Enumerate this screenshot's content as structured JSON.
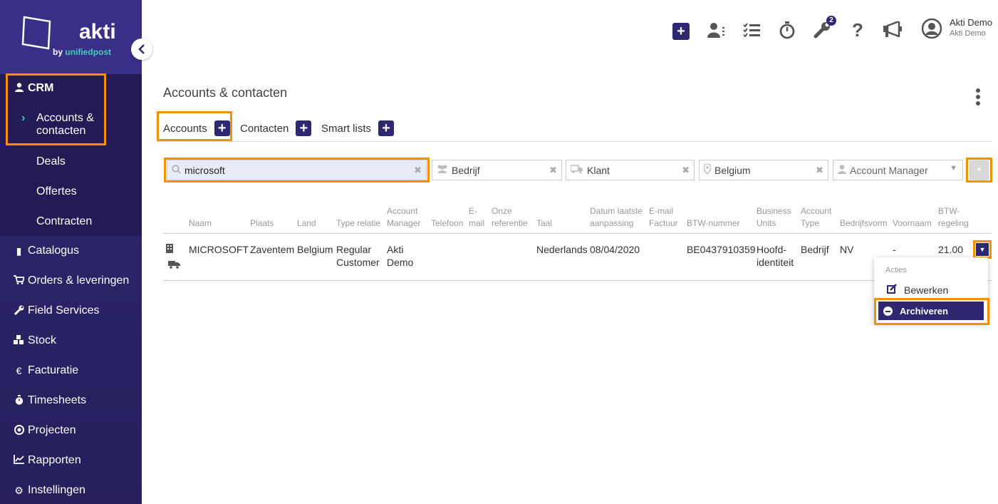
{
  "brand": {
    "name": "akti",
    "sub_prefix": "by",
    "sub_name": "unifiedpost"
  },
  "sidebar": {
    "crm_label": "CRM",
    "crm_sub": [
      {
        "label": "Accounts & contacten"
      },
      {
        "label": "Deals"
      },
      {
        "label": "Offertes"
      },
      {
        "label": "Contracten"
      }
    ],
    "items": [
      {
        "label": "Catalogus",
        "icon": "book-icon"
      },
      {
        "label": "Orders & leveringen",
        "icon": "cart-icon"
      },
      {
        "label": "Field Services",
        "icon": "wrench-icon"
      },
      {
        "label": "Stock",
        "icon": "cubes-icon"
      },
      {
        "label": "Facturatie",
        "icon": "euro-icon"
      },
      {
        "label": "Timesheets",
        "icon": "stopwatch-icon"
      },
      {
        "label": "Projecten",
        "icon": "target-icon"
      },
      {
        "label": "Rapporten",
        "icon": "chart-icon"
      },
      {
        "label": "Instellingen",
        "icon": "gear-icon"
      }
    ]
  },
  "topbar": {
    "badge_count": "2",
    "user_name": "Akti Demo",
    "user_company": "Akti Demo"
  },
  "page": {
    "title": "Accounts & contacten"
  },
  "tabs": [
    {
      "label": "Accounts"
    },
    {
      "label": "Contacten"
    },
    {
      "label": "Smart lists"
    }
  ],
  "filters": {
    "search_value": "microsoft",
    "type": "Bedrijf",
    "relation": "Klant",
    "country": "Belgium",
    "manager_placeholder": "Account Manager"
  },
  "table": {
    "headers": {
      "naam": "Naam",
      "plaats": "Plaats",
      "land": "Land",
      "type_relatie": "Type relatie",
      "account_manager_1": "Account",
      "account_manager_2": "Manager",
      "telefoon": "Telefoon",
      "email_1": "E-",
      "email_2": "mail",
      "onze_ref_1": "Onze",
      "onze_ref_2": "referentie",
      "taal": "Taal",
      "datum_1": "Datum laatste",
      "datum_2": "aanpassing",
      "email_factuur_1": "E-mail",
      "email_factuur_2": "Factuur",
      "btw_nummer": "BTW-nummer",
      "bu_1": "Business",
      "bu_2": "Units",
      "acc_type_1": "Account",
      "acc_type_2": "Type",
      "bedrijfsvorm": "Bedrijfsvorm",
      "voornaam": "Voornaam",
      "btw_regeling_1": "BTW-",
      "btw_regeling_2": "regeling"
    },
    "row": {
      "naam": "MICROSOFT",
      "plaats": "Zaventem",
      "land": "Belgium",
      "type_relatie_1": "Regular",
      "type_relatie_2": "Customer",
      "manager_1": "Akti",
      "manager_2": "Demo",
      "taal": "Nederlands",
      "datum": "08/04/2020",
      "btw": "BE0437910359",
      "bu_1": "Hoofd-",
      "bu_2": "identiteit",
      "acc_type": "Bedrijf",
      "bedrijfsvorm": "NV",
      "voornaam": "-",
      "btw_regeling": "21.00"
    }
  },
  "menu": {
    "heading": "Acties",
    "edit": "Bewerken",
    "archive": "Archiveren"
  },
  "colors": {
    "primary": "#2f2870",
    "highlight": "#f39200",
    "teal": "#3ecfc0"
  }
}
